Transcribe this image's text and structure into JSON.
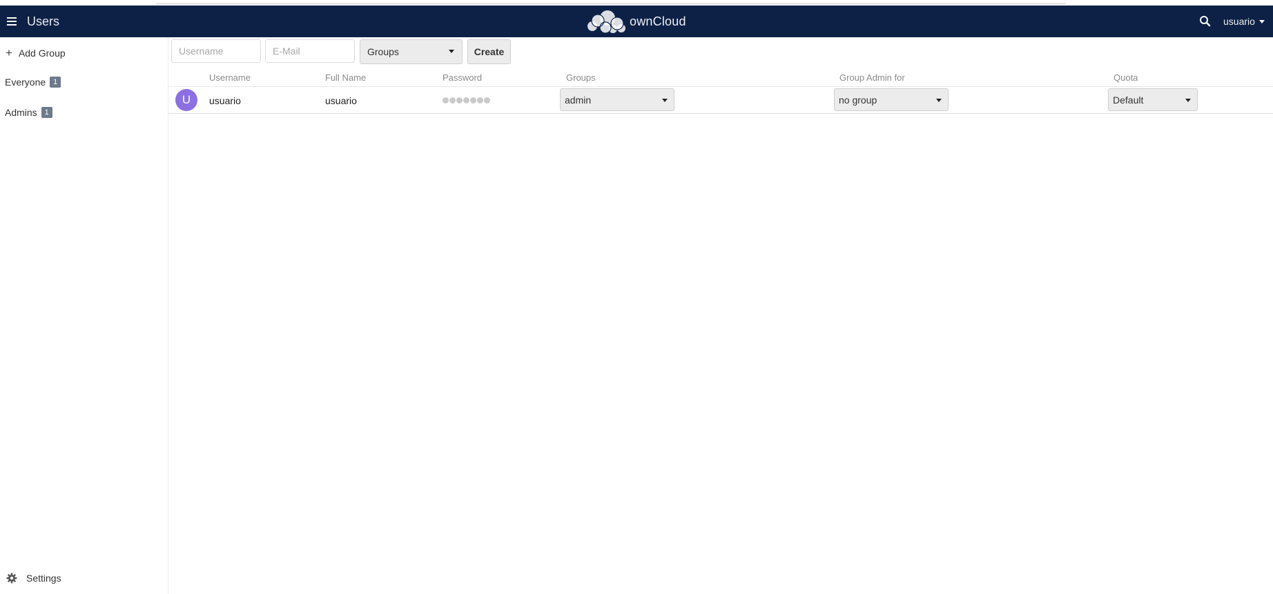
{
  "header": {
    "app_title": "Users",
    "brand_name": "ownCloud",
    "user_name": "usuario",
    "colors": {
      "background": "#0c2145",
      "text": "#ffffff"
    }
  },
  "sidebar": {
    "add_group_label": "Add Group",
    "groups": [
      {
        "name": "Everyone",
        "count": "1"
      },
      {
        "name": "Admins",
        "count": "1"
      }
    ],
    "settings_label": "Settings"
  },
  "new_user_form": {
    "username_placeholder": "Username",
    "email_placeholder": "E-Mail",
    "groups_select_value": "Groups",
    "create_label": "Create"
  },
  "table": {
    "columns": [
      "Username",
      "Full Name",
      "Password",
      "Groups",
      "Group Admin for",
      "Quota"
    ],
    "rows": [
      {
        "avatar_letter": "U",
        "avatar_color": "#8b6fe3",
        "username": "usuario",
        "full_name": "usuario",
        "password_mask": "●●●●●●●",
        "groups": "admin",
        "group_admin_for": "no group",
        "quota": "Default"
      }
    ]
  },
  "icons": {
    "menu": "hamburger-menu-icon",
    "logo": "cloud-logo",
    "search": "search-icon",
    "user_menu": "caret-down-icon",
    "add": "plus-icon",
    "settings": "gear-icon",
    "dropdown": "caret-down-icon"
  }
}
